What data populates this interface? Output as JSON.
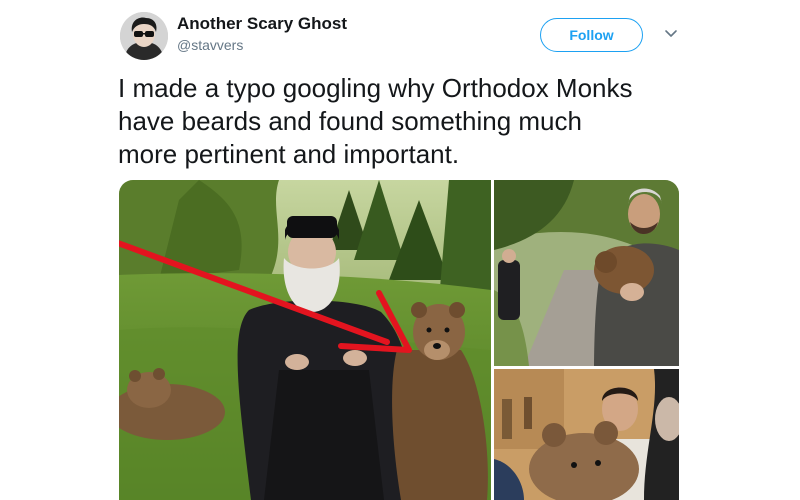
{
  "tweet": {
    "author": {
      "display_name": "Another Scary Ghost",
      "handle": "@stavvers"
    },
    "follow_label": "Follow",
    "text": "I made a typo googling why Orthodox Monks\nhave beards and found something much\nmore pertinent and important.",
    "media_count": 3
  },
  "icons": {
    "avatar": "avatar-with-sunglasses",
    "menu": "chevron-down-icon"
  },
  "colors": {
    "accent": "#1da1f2",
    "text": "#14171a",
    "muted": "#657786",
    "arrow": "#e3141f"
  }
}
